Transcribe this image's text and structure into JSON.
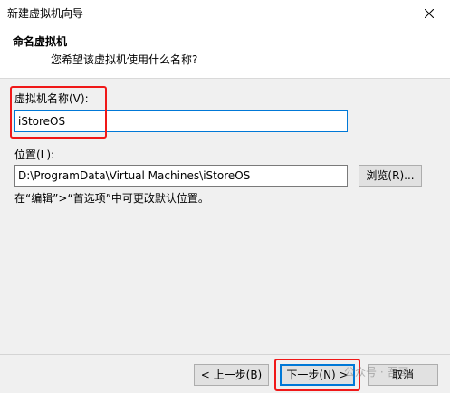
{
  "window": {
    "title": "新建虚拟机向导"
  },
  "header": {
    "title": "命名虚拟机",
    "subtitle": "您希望该虚拟机使用什么名称?"
  },
  "vm_name": {
    "label": "虚拟机名称(V):",
    "value": "iStoreOS"
  },
  "location": {
    "label": "位置(L):",
    "value": "D:\\ProgramData\\Virtual Machines\\iStoreOS",
    "browse_label": "浏览(R)...",
    "hint": "在“编辑”>“首选项”中可更改默认位置。"
  },
  "footer": {
    "back_label": "< 上一步(B)",
    "next_label": "下一步(N) >",
    "cancel_label": "取消"
  },
  "watermark": "公众号 · 吾哥",
  "colors": {
    "accent": "#0078d7",
    "highlight": "#f01818"
  }
}
